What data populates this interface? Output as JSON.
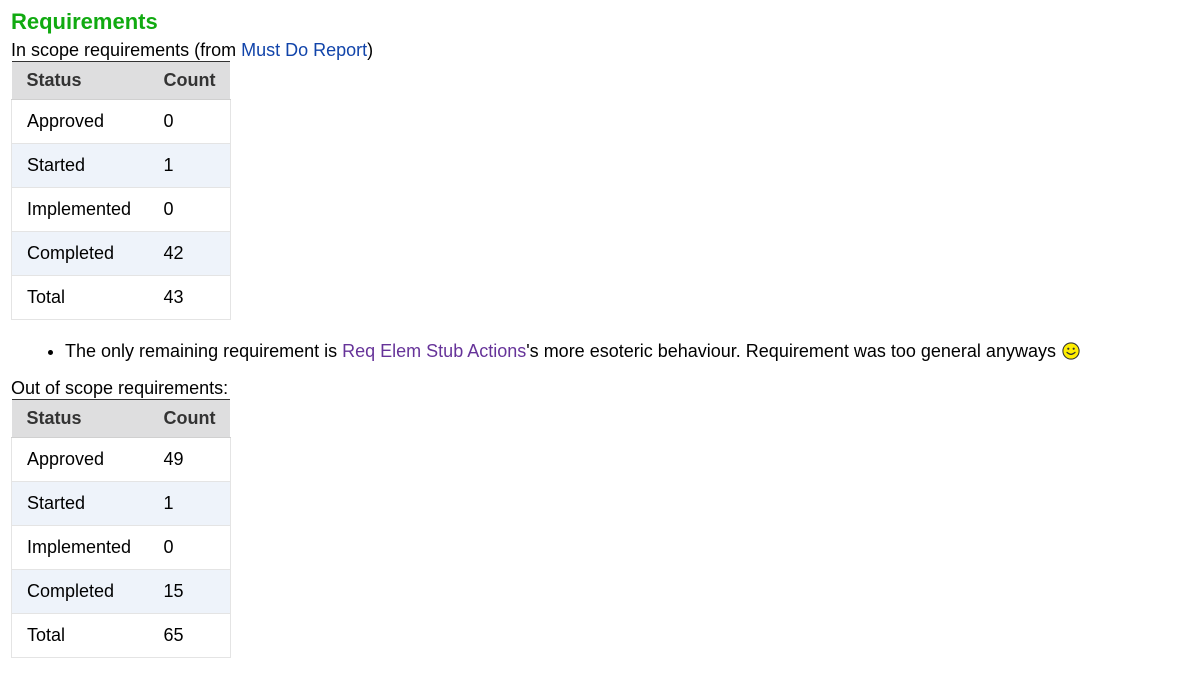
{
  "title": "Requirements",
  "in_scope": {
    "caption_prefix": "In scope requirements (from ",
    "caption_link": "Must Do Report",
    "caption_suffix": ")",
    "headers": [
      "Status",
      "Count"
    ],
    "rows": [
      {
        "status": "Approved",
        "count": "0"
      },
      {
        "status": "Started",
        "count": "1"
      },
      {
        "status": "Implemented",
        "count": "0"
      },
      {
        "status": "Completed",
        "count": "42"
      },
      {
        "status": "Total",
        "count": "43"
      }
    ]
  },
  "note": {
    "prefix": "The only remaining requirement is ",
    "link": "Req Elem Stub Actions",
    "suffix": "'s more esoteric behaviour. Requirement was too general anyways",
    "icon": "smiley-icon"
  },
  "out_of_scope": {
    "caption": "Out of scope requirements:",
    "headers": [
      "Status",
      "Count"
    ],
    "rows": [
      {
        "status": "Approved",
        "count": "49"
      },
      {
        "status": "Started",
        "count": "1"
      },
      {
        "status": "Implemented",
        "count": "0"
      },
      {
        "status": "Completed",
        "count": "15"
      },
      {
        "status": "Total",
        "count": "65"
      }
    ]
  },
  "colors": {
    "title": "#11aa11",
    "link": "#1144aa",
    "visited_link": "#663399",
    "header_bg": "#dededf",
    "alt_row_bg": "#eef3fa"
  }
}
